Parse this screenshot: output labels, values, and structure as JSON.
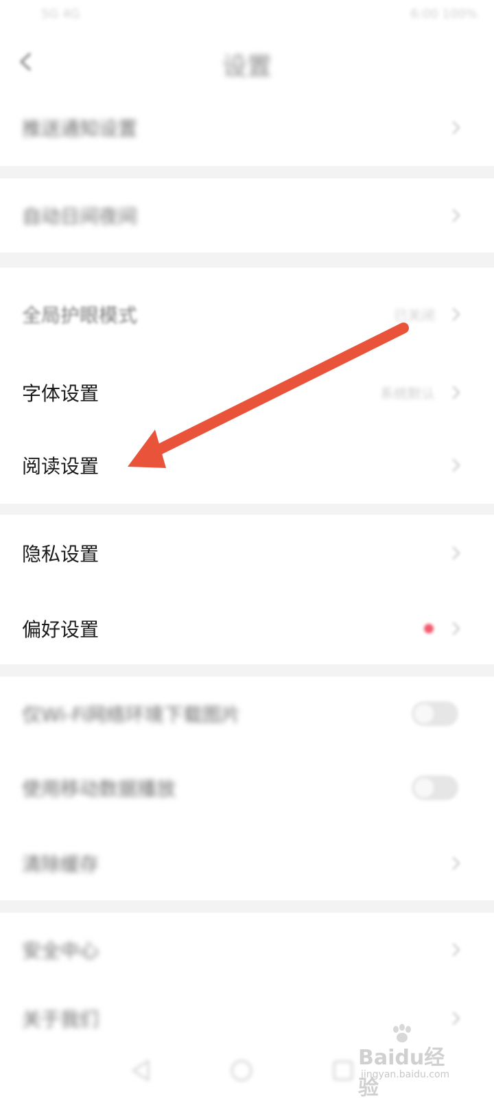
{
  "status_bar": {
    "left_text": "5G 4G",
    "right_text": "6:00 100%"
  },
  "header": {
    "title": "设置",
    "back_icon": "chevron-left-icon"
  },
  "sections": [
    {
      "rows": [
        {
          "label": "推送通知设置",
          "value": "",
          "accessory": "chevron"
        }
      ]
    },
    {
      "rows": [
        {
          "label": "自动日间夜间",
          "value": "",
          "accessory": "chevron"
        }
      ]
    },
    {
      "rows": [
        {
          "label": "全局护眼模式",
          "value": "已关闭",
          "accessory": "chevron"
        },
        {
          "label": "字体设置",
          "value": "系统默认",
          "accessory": "chevron"
        },
        {
          "label": "阅读设置",
          "value": "",
          "accessory": "chevron"
        }
      ]
    },
    {
      "rows": [
        {
          "label": "隐私设置",
          "value": "",
          "accessory": "chevron"
        },
        {
          "label": "偏好设置",
          "value": "",
          "accessory": "red-dot-chevron"
        }
      ]
    },
    {
      "rows": [
        {
          "label": "仅Wi-Fi网络环境下载图片",
          "value": "",
          "accessory": "toggle"
        },
        {
          "label": "使用移动数据播放",
          "value": "",
          "accessory": "toggle"
        },
        {
          "label": "清除缓存",
          "value": "",
          "accessory": "chevron"
        }
      ]
    },
    {
      "rows": [
        {
          "label": "安全中心",
          "value": "",
          "accessory": "chevron"
        },
        {
          "label": "关于我们",
          "value": "",
          "accessory": "chevron"
        }
      ]
    }
  ],
  "annotation": {
    "arrow_color": "#e8533a"
  },
  "watermark": {
    "brand": "Baidu经验",
    "url": "jingyan.baidu.com"
  },
  "colors": {
    "text_primary": "#1a1a1a",
    "divider": "#f3f3f3",
    "red_dot": "#f25a6e"
  }
}
